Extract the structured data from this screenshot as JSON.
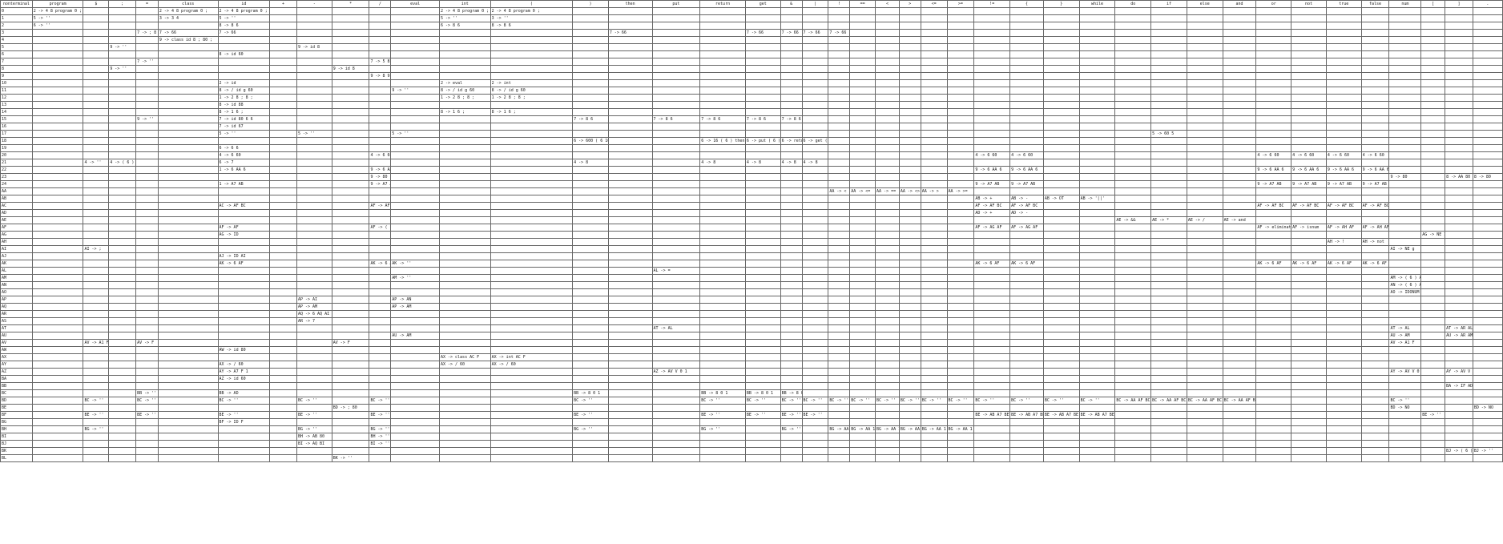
{
  "table": {
    "headers": [
      "nonterminal",
      "program",
      "$",
      ";",
      "=",
      "class",
      "id",
      "+",
      "-",
      "*",
      "/",
      "eval",
      "int",
      "(",
      ")",
      "then",
      "put",
      "return",
      "get",
      "&",
      "|",
      "!",
      "==",
      "<",
      ">",
      "<=",
      ">=",
      "!=",
      "{",
      "}",
      "while",
      "do",
      "if",
      "else",
      "and",
      "or",
      "not",
      "true",
      "false",
      "num",
      "[",
      "]",
      "."
    ],
    "rows": [
      {
        "label": "0",
        "cells": {
          "1": "2 -> 4 8 program 0 ;",
          "5": "2 -> 4 8 program 0 ;",
          "6": "2 -> 4 8 program 0 ;",
          "12": "2 -> 4 8 program 0 ;",
          "13": "2 -> 4 8 program 0 ;"
        }
      },
      {
        "label": "1",
        "cells": {
          "1": "5 -> ''",
          "5": "3 -> 3 4",
          "6": "5 -> ''",
          "12": "5 -> ''",
          "13": "3 -> ''"
        }
      },
      {
        "label": "2",
        "cells": {
          "1": "6 -> ''",
          "6": "8 -> 8 6",
          "12": "6 -> 8 6",
          "13": "8 -> 8 6"
        }
      },
      {
        "label": "3",
        "cells": {
          "4": "7 -> ; 8 6",
          "5": "7 -> 66",
          "6": "7 -> 66",
          "15": "7 -> 66",
          "18": "7 -> 66",
          "19": "7 -> 66",
          "20": "7 -> 66",
          "21": "7 -> 66"
        }
      },
      {
        "label": "4",
        "cells": {
          "5": "9 -> class id 8 ; 80 ;"
        }
      },
      {
        "label": "5",
        "cells": {
          "3": "9 -> ''",
          "8": "9 -> id 8"
        }
      },
      {
        "label": "6",
        "cells": {
          "6": "8 -> id 60"
        }
      },
      {
        "label": "7",
        "cells": {
          "4": "7 -> ''",
          "10": "7 -> 5 8"
        }
      },
      {
        "label": "8",
        "cells": {
          "3": "9 -> ''",
          "9": "9 -> id 8"
        }
      },
      {
        "label": "9",
        "cells": {
          "10": "9 -> 8 9 ;"
        }
      },
      {
        "label": "10",
        "cells": {
          "6": "2 -> id",
          "12": "2 -> eval",
          "13": "2 -> int"
        }
      },
      {
        "label": "11",
        "cells": {
          "6": "8 -> / id g 60",
          "11": "9 -> ''",
          "12": "8 -> / id g 60",
          "13": "8 -> / id g 60"
        }
      },
      {
        "label": "12",
        "cells": {
          "6": "1 -> 2 8 ; 8 ;",
          "12": "1 -> 2 8 ; 8 ;",
          "13": "1 -> 2 8 ; 8 ;"
        }
      },
      {
        "label": "13",
        "cells": {
          "6": "8 -> id 88"
        }
      },
      {
        "label": "14",
        "cells": {
          "6": "8 -> 1 6 ;",
          "12": "8 -> 1 6 ;",
          "13": "8 -> 1 6 ;"
        }
      },
      {
        "label": "15",
        "cells": {
          "4": "9 -> ''",
          "6": "7 -> id 80 6 6",
          "14": "7 -> 8 6",
          "16": "7 -> 8 6",
          "17": "7 -> 8 6",
          "18": "7 -> 8 6",
          "19": "7 -> 8 6"
        }
      },
      {
        "label": "16",
        "cells": {
          "6": "7 -> id 67"
        }
      },
      {
        "label": "17",
        "cells": {
          "6": "5 -> ''",
          "8": "5 -> ''",
          "11": "5 -> ''",
          "32": "5 -> 60 5"
        }
      },
      {
        "label": "18",
        "cells": {
          "14": "6 -> 600 ( 6 16 ) 6 , 6 ; 7 ; 6",
          "17": "6 -> 16 ( 6 ) then 6 ,",
          "18": "6 -> put ( 6 ) ;",
          "19": "6 -> return ( 6 ) ;",
          "20": "6 -> get ( 6 ) ;"
        }
      },
      {
        "label": "19",
        "cells": {
          "6": "6 -> 6 6"
        }
      },
      {
        "label": "20",
        "cells": {
          "6": "4 -> 6 60",
          "10": "4 -> 6 60",
          "27": "4 -> 6 60",
          "28": "4 -> 6 60",
          "35": "4 -> 6 60",
          "36": "4 -> 6 60",
          "37": "4 -> 6 60",
          "38": "4 -> 6 60"
        }
      },
      {
        "label": "21",
        "cells": {
          "2": "4 -> ''",
          "3": "4 -> ( 6 )",
          "6": "6 -> 7",
          "14": "4 -> 8",
          "17": "4 -> 8",
          "18": "4 -> 8",
          "19": "4 -> 8",
          "20": "4 -> 8"
        }
      },
      {
        "label": "22",
        "cells": {
          "6": "1 -> 6 AA 6",
          "10": "9 -> 6 AA 6",
          "27": "9 -> 6 AA 6",
          "28": "9 -> 6 AA 6",
          "35": "9 -> 6 AA 6",
          "36": "9 -> 6 AA 6",
          "37": "9 -> 6 AA 6",
          "38": "9 -> 6 AA 6"
        }
      },
      {
        "label": "23",
        "cells": {
          "10": "9 -> 80",
          "39": "9 -> 80",
          "41": "8 -> AA 80",
          "42": "8 -> 80"
        }
      },
      {
        "label": "24",
        "cells": {
          "6": "1 -> A7 AB",
          "10": "9 -> A7 AB",
          "27": "9 -> A7 AB",
          "28": "9 -> A7 AB",
          "35": "9 -> A7 AB",
          "36": "9 -> A7 AB",
          "37": "9 -> A7 AB",
          "38": "9 -> A7 AB"
        }
      },
      {
        "label": "AA",
        "cells": {
          "21": "AA -> <",
          "22": "AA -> <=",
          "23": "AA -> ==",
          "24": "AA -> <>",
          "25": "AA -> >",
          "26": "AA -> >="
        }
      },
      {
        "label": "AB",
        "cells": {
          "27": "AB -> +",
          "28": "AB -> -",
          "29": "AB -> OT",
          "30": "AB -> '||'"
        }
      },
      {
        "label": "AC",
        "cells": {
          "6": "AC -> AF BC",
          "10": "AF -> AF BC",
          "27": "AF -> AF BC",
          "28": "AF -> AF BC",
          "35": "AF -> AF BC",
          "36": "AF -> AF BC",
          "37": "AF -> AF BC",
          "38": "AF -> AF BC"
        }
      },
      {
        "label": "AD",
        "cells": {
          "27": "AD -> +",
          "28": "AD -> -"
        }
      },
      {
        "label": "AE",
        "cells": {
          "31": "AE -> &&",
          "32": "AE -> *",
          "33": "AE -> /",
          "34": "AE -> and"
        }
      },
      {
        "label": "AF",
        "cells": {
          "6": "AF -> AF",
          "10": "AF -> ( E )",
          "27": "AF -> AG AF",
          "28": "AF -> AG AF",
          "35": "AF -> eliminate",
          "36": "AF -> isnum",
          "37": "AF -> AH AF",
          "38": "AF -> AH AF"
        }
      },
      {
        "label": "AG",
        "cells": {
          "6": "AG -> ID",
          "40": "AG -> NE ID"
        }
      },
      {
        "label": "AH",
        "cells": {
          "37": "AH -> !",
          "38": "AH -> not"
        }
      },
      {
        "label": "AI",
        "cells": {
          "2": "AI -> ;",
          "39": "AI -> NE g"
        }
      },
      {
        "label": "AJ",
        "cells": {
          "6": "AJ -> ID AI"
        }
      },
      {
        "label": "AK",
        "cells": {
          "6": "AK -> 6 AF",
          "10": "AK -> 6 AF",
          "11": "AK -> ''",
          "27": "AK -> 6 AF",
          "28": "AK -> 6 AF",
          "35": "AK -> 6 AF",
          "36": "AK -> 6 AF",
          "37": "AK -> 6 AF",
          "38": "AK -> 6 AF"
        }
      },
      {
        "label": "AL",
        "cells": {
          "16": "AL -> ="
        }
      },
      {
        "label": "AM",
        "cells": {
          "11": "AM -> ''",
          "39": "AM -> ( 6 ) AI"
        }
      },
      {
        "label": "AN",
        "cells": {
          "39": "AN -> ( 6 ) AI"
        }
      },
      {
        "label": "AO",
        "cells": {
          "39": "AO -> IDONUM"
        }
      },
      {
        "label": "AP",
        "cells": {
          "8": "AP -> AI",
          "11": "AP -> AN"
        }
      },
      {
        "label": "AQ",
        "cells": {
          "8": "AP -> AM",
          "11": "AP -> AM"
        }
      },
      {
        "label": "AR",
        "cells": {
          "8": "AQ -> 6 AQ AI"
        }
      },
      {
        "label": "AS",
        "cells": {
          "8": "AR -> 7"
        }
      },
      {
        "label": "AT",
        "cells": {
          "16": "AT -> AL",
          "39": "AT -> AL",
          "41": "AT -> AR AL"
        }
      },
      {
        "label": "AU",
        "cells": {
          "11": "AU -> AM",
          "39": "AU -> AM",
          "41": "AU -> AR AM"
        }
      },
      {
        "label": "AV",
        "cells": {
          "2": "AV -> A1 F",
          "4": "AV -> F",
          "9": "AV -> F",
          "39": "AV -> A1 F"
        }
      },
      {
        "label": "AW",
        "cells": {
          "6": "AW -> id 80"
        }
      },
      {
        "label": "AX",
        "cells": {
          "12": "AX -> class AC F",
          "13": "AX -> int AC F"
        }
      },
      {
        "label": "AY",
        "cells": {
          "6": "AX -> / 60",
          "12": "AX -> / 60",
          "13": "AX -> / 60"
        }
      },
      {
        "label": "AZ",
        "cells": {
          "6": "AY -> A7 F 1",
          "16": "AZ -> AV V 0 1",
          "39": "AY -> AV V 0 1",
          "41": "AY -> AV V 0 1"
        }
      },
      {
        "label": "BA",
        "cells": {
          "6": "AZ -> id 60"
        }
      },
      {
        "label": "BB",
        "cells": {
          "41": "BA -> IF AD"
        }
      },
      {
        "label": "BC",
        "cells": {
          "4": "BB -> ''",
          "6": "BB -> AD",
          "14": "BB -> 8 0 1",
          "17": "BB -> 8 0 1",
          "18": "BB -> 8 0 1",
          "19": "BB -> 8 0 1"
        }
      },
      {
        "label": "BD",
        "cells": {
          "2": "BC -> ''",
          "4": "BC -> ''",
          "6": "BC -> ''",
          "8": "BC -> ''",
          "10": "BC -> ''",
          "14": "BC -> ''",
          "17": "BC -> ''",
          "18": "BC -> ''",
          "19": "BC -> ''",
          "20": "BC -> ''",
          "21": "BC -> ''",
          "22": "BC -> ''",
          "23": "BC -> ''",
          "24": "BC -> ''",
          "25": "BC -> ''",
          "26": "BC -> ''",
          "27": "BC -> ''",
          "28": "BC -> ''",
          "29": "BC -> ''",
          "30": "BC -> ''",
          "31": "BC -> AA AF BC",
          "32": "BC -> AA AF BC",
          "33": "BC -> AA AF BC",
          "34": "BC -> AA AF BC",
          "39": "BC -> ''"
        }
      },
      {
        "label": "BE",
        "cells": {
          "9": "BD -> ; 80",
          "39": "BD -> NO",
          "42": "BD -> NO"
        }
      },
      {
        "label": "BF",
        "cells": {
          "2": "BE -> ''",
          "4": "BE -> ''",
          "6": "BE -> ''",
          "8": "BE -> ''",
          "10": "BE -> ''",
          "14": "BE -> ''",
          "17": "BE -> ''",
          "18": "BE -> ''",
          "19": "BE -> ''",
          "20": "BE -> ''",
          "27": "BE -> AB A7 BE",
          "28": "BE -> AB A7 BE",
          "29": "BE -> AB A7 BE",
          "30": "BE -> AB A7 BE",
          "40": "BE -> ''"
        }
      },
      {
        "label": "BG",
        "cells": {
          "6": "BF -> ID F"
        }
      },
      {
        "label": "BH",
        "cells": {
          "2": "BG -> ''",
          "8": "BG -> ''",
          "10": "BG -> ''",
          "14": "BG -> ''",
          "17": "BG -> ''",
          "19": "BG -> ''",
          "21": "BG -> AA 1",
          "22": "BG -> AA 1",
          "23": "BG -> AA 1",
          "24": "BG -> AA 1",
          "25": "BG -> AA 1",
          "26": "BG -> AA 1"
        }
      },
      {
        "label": "BI",
        "cells": {
          "8": "BH -> AB 80",
          "10": "BH -> ''"
        }
      },
      {
        "label": "BJ",
        "cells": {
          "8": "BI -> AQ BI",
          "10": "BI -> ''"
        }
      },
      {
        "label": "BK",
        "cells": {
          "41": "BJ -> ( 6 ) AI",
          "42": "BJ -> ''"
        }
      },
      {
        "label": "BL",
        "cells": {
          "9": "BK -> ''"
        }
      }
    ]
  }
}
